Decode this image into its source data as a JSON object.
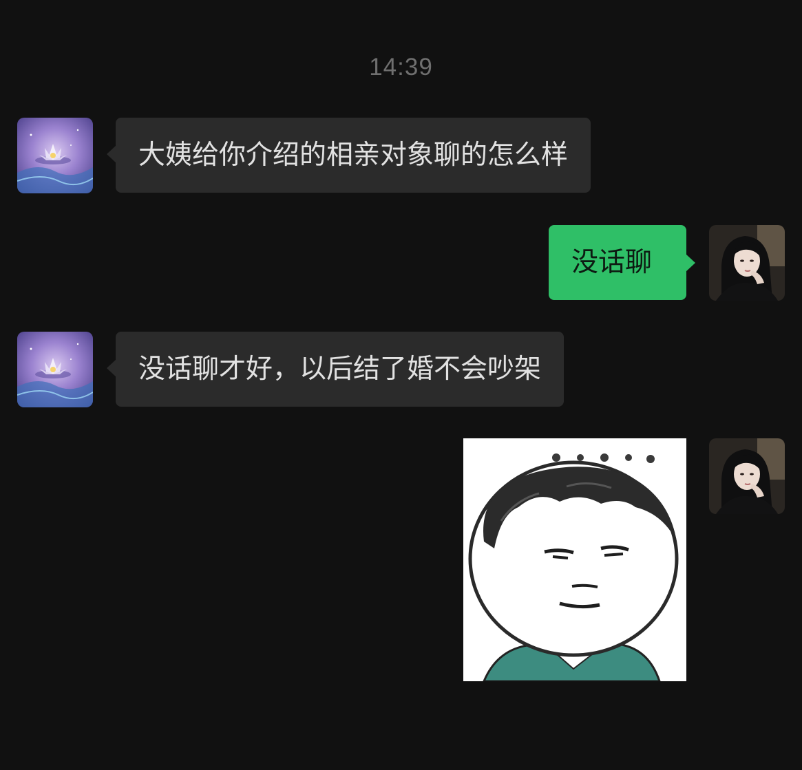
{
  "chat": {
    "timestamp": "14:39",
    "messages": [
      {
        "sender": "other",
        "type": "text",
        "text": "大姨给你介绍的相亲对象聊的怎么样"
      },
      {
        "sender": "self",
        "type": "text",
        "text": "没话聊"
      },
      {
        "sender": "other",
        "type": "text",
        "text": "没话聊才好，以后结了婚不会吵架"
      },
      {
        "sender": "self",
        "type": "sticker",
        "icon": "meme-face-sticker"
      }
    ]
  },
  "colors": {
    "background": "#111111",
    "incoming_bubble": "#2b2b2b",
    "outgoing_bubble": "#2fbf67",
    "timestamp_text": "#6f6f6f"
  },
  "avatars": {
    "other": "lotus-avatar-icon",
    "self": "girl-portrait-avatar-icon"
  }
}
